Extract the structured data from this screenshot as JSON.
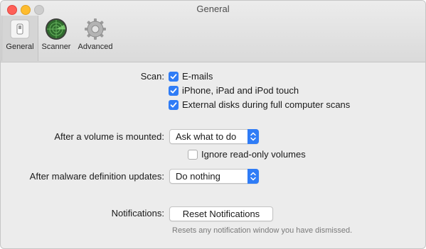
{
  "window": {
    "title": "General"
  },
  "toolbar": {
    "items": [
      {
        "label": "General",
        "icon": "switch-icon",
        "selected": true
      },
      {
        "label": "Scanner",
        "icon": "radar-icon",
        "selected": false
      },
      {
        "label": "Advanced",
        "icon": "gear-icon",
        "selected": false
      }
    ]
  },
  "scan": {
    "label": "Scan:",
    "options": [
      {
        "label": "E-mails",
        "checked": true
      },
      {
        "label": "iPhone, iPad and iPod touch",
        "checked": true
      },
      {
        "label": "External disks during full computer scans",
        "checked": true
      }
    ]
  },
  "volume": {
    "label": "After a volume is mounted:",
    "selected": "Ask what to do",
    "ignore_readonly": {
      "label": "Ignore read-only volumes",
      "checked": false
    }
  },
  "malware_updates": {
    "label": "After malware definition updates:",
    "selected": "Do nothing"
  },
  "notifications": {
    "label": "Notifications:",
    "button_label": "Reset Notifications",
    "hint": "Resets any notification window you have dismissed."
  },
  "colors": {
    "accent": "#2f7cf6",
    "close": "#fe5f57",
    "minimize": "#febc2e"
  }
}
